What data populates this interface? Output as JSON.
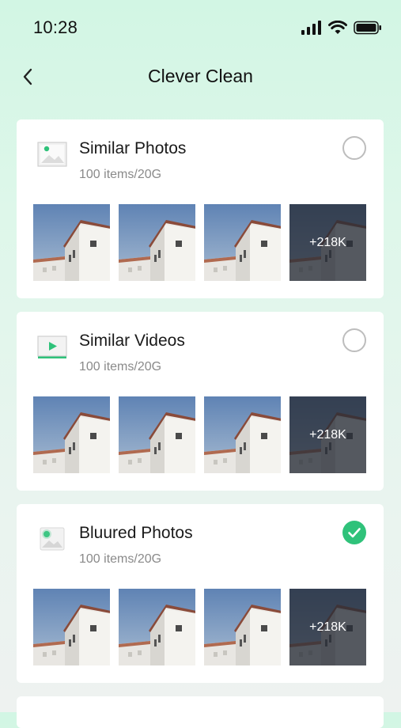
{
  "status_bar": {
    "time": "10:28"
  },
  "nav": {
    "title": "Clever Clean",
    "back_icon": "chevron-left-icon"
  },
  "colors": {
    "accent": "#2fc27a",
    "card_bg": "#ffffff",
    "bg_top": "#d2f6e4"
  },
  "cards": [
    {
      "title": "Similar Photos",
      "subtitle": "100 items/20G",
      "icon": "photo-icon",
      "selected": false,
      "more_count": "+218K"
    },
    {
      "title": "Similar Videos",
      "subtitle": "100 items/20G",
      "icon": "video-icon",
      "selected": false,
      "more_count": "+218K"
    },
    {
      "title": "Bluured Photos",
      "subtitle": "100 items/20G",
      "icon": "blurred-photo-icon",
      "selected": true,
      "more_count": "+218K"
    }
  ]
}
